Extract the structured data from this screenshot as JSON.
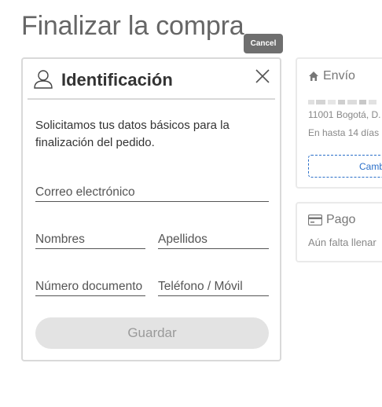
{
  "page": {
    "title": "Finalizar la compra"
  },
  "cancel_label": "Cancel",
  "identification": {
    "title": "Identificación",
    "intro": "Solicitamos tus datos básicos para la finalización del pedido.",
    "fields": {
      "email": "Correo electrónico",
      "first_names": "Nombres",
      "last_names": "Apellidos",
      "document": "Número documento",
      "phone": "Teléfono / Móvil"
    },
    "save_label": "Guardar"
  },
  "shipping": {
    "title": "Envío",
    "city_line": "11001 Bogotá, D.",
    "eta": "En hasta 14 días",
    "change_label": "Camb"
  },
  "payment": {
    "title": "Pago",
    "status": "Aún falta llenar"
  },
  "colors": {
    "accent_link": "#2a6fc9",
    "cancel_bg": "#6f6f6f",
    "disabled_button": "#e3e3e3",
    "card_border": "#d9d9d9"
  },
  "icons": {
    "identification": "user-icon",
    "close": "close-icon",
    "shipping": "home-icon",
    "payment": "credit-card-icon"
  }
}
